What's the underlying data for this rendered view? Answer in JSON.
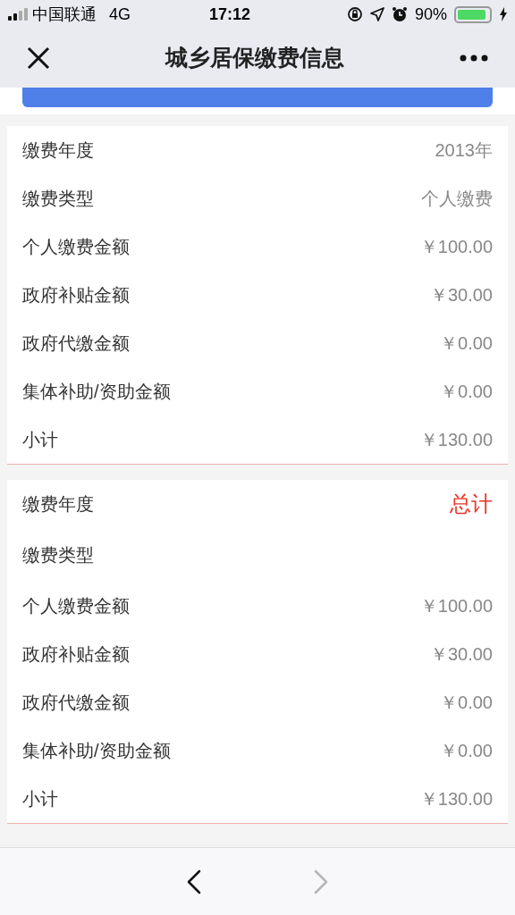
{
  "status_bar": {
    "carrier": "中国联通",
    "network": "4G",
    "time": "17:12",
    "battery": "90%"
  },
  "header": {
    "title": "城乡居保缴费信息"
  },
  "cards": [
    {
      "rows": [
        {
          "label": "缴费年度",
          "value": "2013年",
          "kind": "plain"
        },
        {
          "label": "缴费类型",
          "value": "个人缴费",
          "kind": "plain"
        },
        {
          "label": "个人缴费金额",
          "value": "￥100.00",
          "kind": "plain"
        },
        {
          "label": "政府补贴金额",
          "value": "￥30.00",
          "kind": "plain"
        },
        {
          "label": "政府代缴金额",
          "value": "￥0.00",
          "kind": "plain"
        },
        {
          "label": "集体补助/资助金额",
          "value": "￥0.00",
          "kind": "plain"
        },
        {
          "label": "小计",
          "value": "￥130.00",
          "kind": "plain"
        }
      ]
    },
    {
      "rows": [
        {
          "label": "缴费年度",
          "value": "总计",
          "kind": "highlight"
        },
        {
          "label": "缴费类型",
          "kind": "plain"
        },
        {
          "label": "个人缴费金额",
          "value": "￥100.00",
          "kind": "plain"
        },
        {
          "label": "政府补贴金额",
          "value": "￥30.00",
          "kind": "plain"
        },
        {
          "label": "政府代缴金额",
          "value": "￥0.00",
          "kind": "plain"
        },
        {
          "label": "集体补助/资助金额",
          "value": "￥0.00",
          "kind": "plain"
        },
        {
          "label": "小计",
          "value": "￥130.00",
          "kind": "plain"
        }
      ]
    }
  ],
  "toolbar": {
    "back": {
      "disabled": false
    },
    "forward": {
      "disabled": true
    }
  }
}
